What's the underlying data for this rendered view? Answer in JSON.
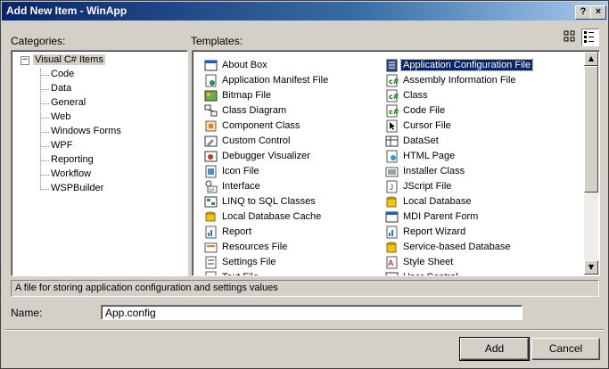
{
  "window": {
    "title": "Add New Item - WinApp",
    "help_button": "?",
    "close_button": "×"
  },
  "categories": {
    "label": "Categories:",
    "root": "Visual C# Items",
    "items": [
      "Code",
      "Data",
      "General",
      "Web",
      "Windows Forms",
      "WPF",
      "Reporting",
      "Workflow",
      "WSPBuilder"
    ]
  },
  "templates": {
    "label": "Templates:",
    "left_column": [
      {
        "label": "About Box",
        "icon": "form-icon"
      },
      {
        "label": "Application Manifest File",
        "icon": "manifest-icon"
      },
      {
        "label": "Bitmap File",
        "icon": "bitmap-icon"
      },
      {
        "label": "Class Diagram",
        "icon": "class-diagram-icon"
      },
      {
        "label": "Component Class",
        "icon": "component-icon"
      },
      {
        "label": "Custom Control",
        "icon": "custom-control-icon"
      },
      {
        "label": "Debugger Visualizer",
        "icon": "debugger-icon"
      },
      {
        "label": "Icon File",
        "icon": "icon-file-icon"
      },
      {
        "label": "Interface",
        "icon": "interface-icon"
      },
      {
        "label": "LINQ to SQL Classes",
        "icon": "linq-icon"
      },
      {
        "label": "Local Database Cache",
        "icon": "database-cache-icon"
      },
      {
        "label": "Report",
        "icon": "report-icon"
      },
      {
        "label": "Resources File",
        "icon": "resources-icon"
      },
      {
        "label": "Settings File",
        "icon": "settings-icon"
      },
      {
        "label": "Text File",
        "icon": "text-file-icon"
      }
    ],
    "right_column": [
      {
        "label": "Application Configuration File",
        "icon": "config-file-icon",
        "selected": true
      },
      {
        "label": "Assembly Information File",
        "icon": "csharp-file-icon"
      },
      {
        "label": "Class",
        "icon": "csharp-file-icon"
      },
      {
        "label": "Code File",
        "icon": "csharp-file-icon"
      },
      {
        "label": "Cursor File",
        "icon": "cursor-icon"
      },
      {
        "label": "DataSet",
        "icon": "dataset-icon"
      },
      {
        "label": "HTML Page",
        "icon": "html-icon"
      },
      {
        "label": "Installer Class",
        "icon": "installer-icon"
      },
      {
        "label": "JScript File",
        "icon": "jscript-icon"
      },
      {
        "label": "Local Database",
        "icon": "database-icon"
      },
      {
        "label": "MDI Parent Form",
        "icon": "form-icon"
      },
      {
        "label": "Report Wizard",
        "icon": "report-icon"
      },
      {
        "label": "Service-based Database",
        "icon": "database-icon"
      },
      {
        "label": "Style Sheet",
        "icon": "stylesheet-icon"
      },
      {
        "label": "User Control",
        "icon": "user-control-icon"
      }
    ]
  },
  "description": "A file for storing application configuration and settings values",
  "name_field": {
    "label": "Name:",
    "value": "App.config"
  },
  "buttons": {
    "add": "Add",
    "cancel": "Cancel"
  },
  "colors": {
    "title_start": "#0a246a",
    "title_end": "#a6caf0",
    "selection": "#0a246a",
    "face": "#d4d0c8"
  }
}
